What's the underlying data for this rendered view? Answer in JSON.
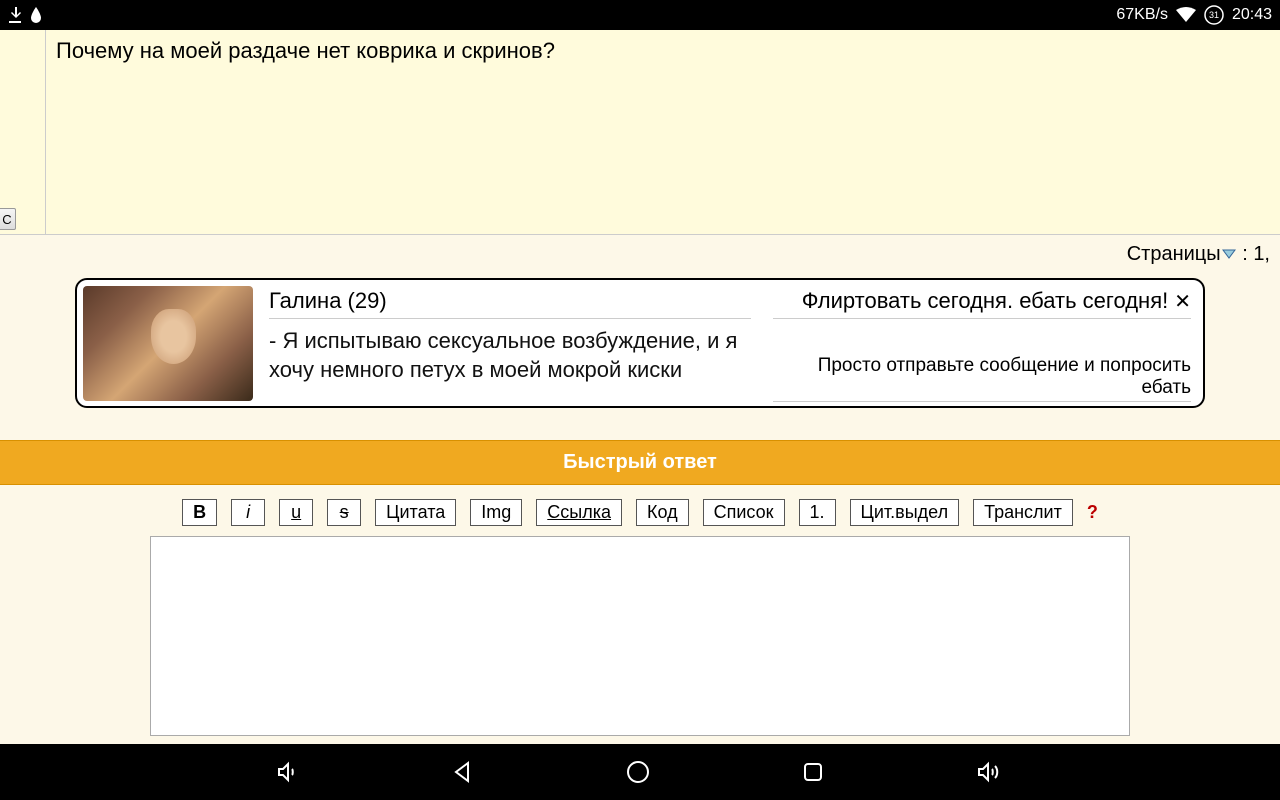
{
  "status_bar": {
    "network_speed": "67KB/s",
    "time": "20:43",
    "date_badge": "31"
  },
  "post": {
    "c_button": "C",
    "text": "Почему на моей раздаче нет коврика и скринов?"
  },
  "pagination": {
    "label": "Страницы",
    "page_numbers": "1,"
  },
  "ad": {
    "name": "Галина (29)",
    "body": "- Я испытываю сексуальное возбуждение, и я хочу немного петух в моей мокрой киски",
    "headline": "Флиртовать сегодня. ебать сегодня!",
    "subtext": "Просто отправьте сообщение и попросить ебать",
    "close": "✕"
  },
  "quick_reply": {
    "header": "Быстрый ответ"
  },
  "toolbar": {
    "bold": "B",
    "italic": "i",
    "underline": "u",
    "strike": "s",
    "quote": "Цитата",
    "img": "Img",
    "link": "Ссылка",
    "code": "Код",
    "list": "Список",
    "list_num": "1.",
    "cite_select": "Цит.выдел",
    "translit": "Транслит",
    "help": "?"
  },
  "reply": {
    "value": ""
  },
  "colon_space": " : "
}
